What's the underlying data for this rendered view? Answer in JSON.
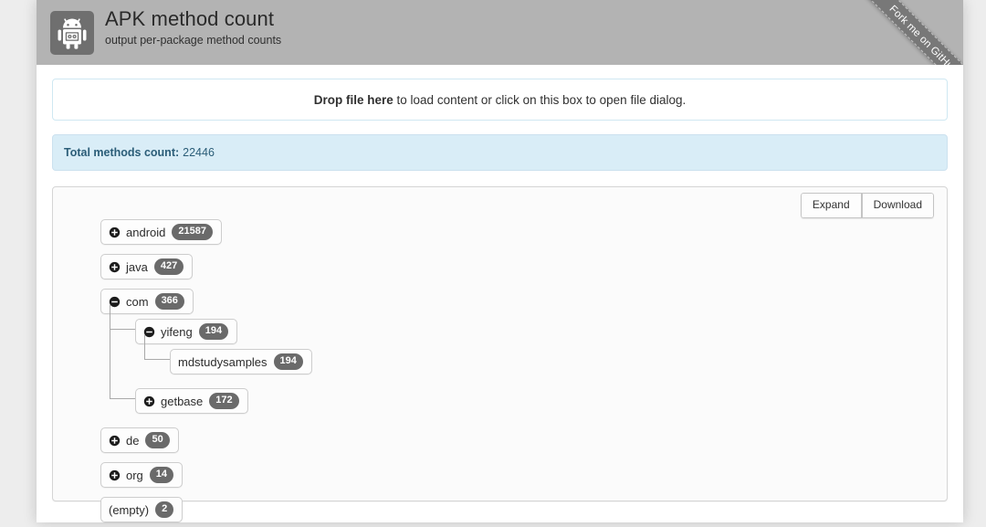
{
  "header": {
    "title": "APK method count",
    "subtitle": "output per-package method counts",
    "logo_icon": "android-robot-icon",
    "logo_bg": "#6f6f6f",
    "bar_bg": "#b3b3b3"
  },
  "ribbon": {
    "label": "Fork me on GitHub",
    "color": "#787878"
  },
  "drop_zone": {
    "strong_text": "Drop file here",
    "rest_text": " to load content or click on this box to open file dialog.",
    "border_color": "#cfe8f2"
  },
  "total": {
    "label": "Total methods count:",
    "value": "22446",
    "bg": "#d9edf7",
    "text_color": "#2b5d78"
  },
  "toolbar": {
    "expand_label": "Expand",
    "download_label": "Download",
    "download_bg": "#2a6ab0"
  },
  "tree": {
    "nodes": [
      {
        "label": "android",
        "count": "21587",
        "toggle": "plus",
        "children": []
      },
      {
        "label": "java",
        "count": "427",
        "toggle": "plus",
        "children": []
      },
      {
        "label": "com",
        "count": "366",
        "toggle": "minus",
        "children": [
          {
            "label": "yifeng",
            "count": "194",
            "toggle": "minus",
            "children": [
              {
                "label": "mdstudysamples",
                "count": "194",
                "toggle": "none",
                "children": []
              }
            ]
          },
          {
            "label": "getbase",
            "count": "172",
            "toggle": "plus",
            "children": []
          }
        ]
      },
      {
        "label": "de",
        "count": "50",
        "toggle": "plus",
        "children": []
      },
      {
        "label": "org",
        "count": "14",
        "toggle": "plus",
        "children": []
      },
      {
        "label": "(empty)",
        "count": "2",
        "toggle": "none",
        "children": []
      }
    ],
    "badge_bg": "#6a6a6a",
    "connector_color": "#a9a9a9"
  }
}
